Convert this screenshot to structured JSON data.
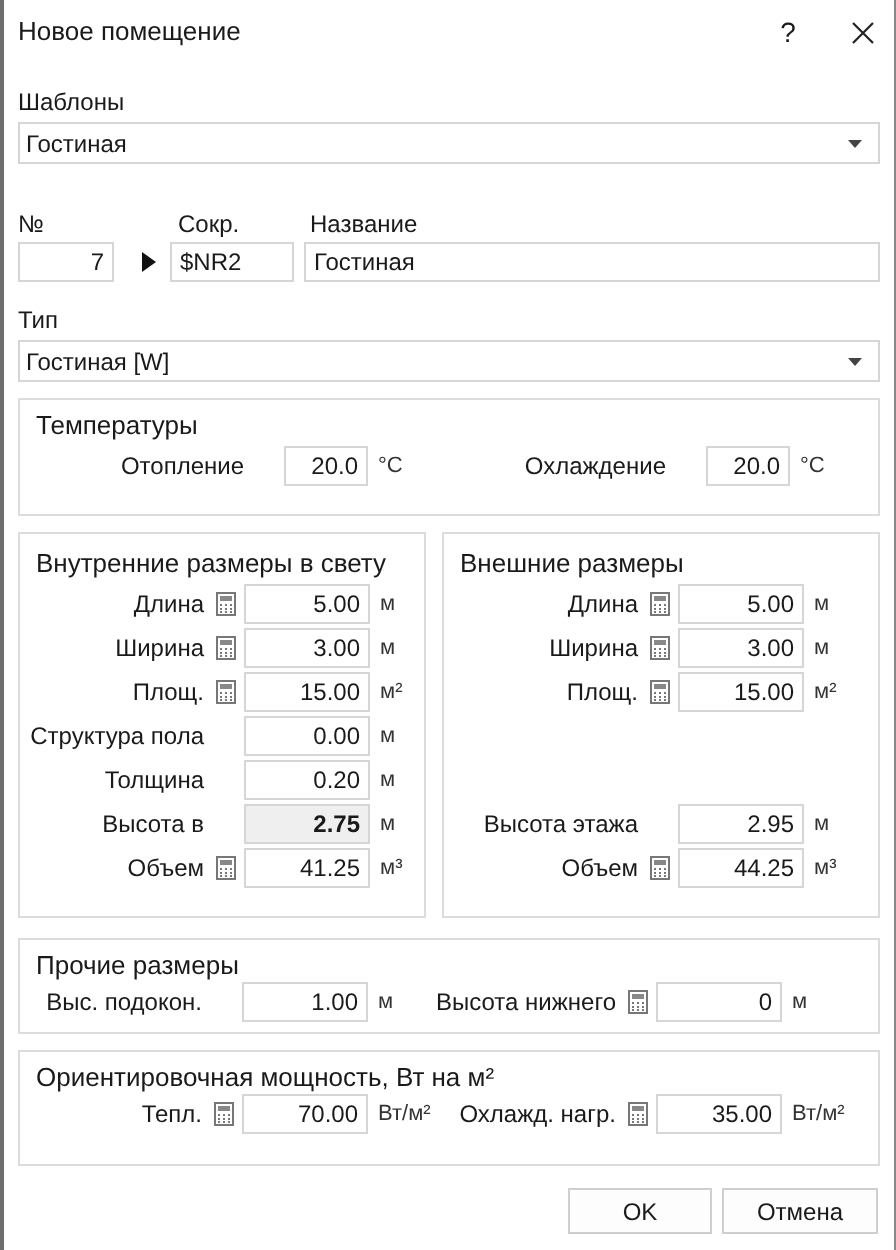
{
  "window": {
    "title": "Новое помещение",
    "help": "?"
  },
  "templates": {
    "label": "Шаблоны",
    "value": "Гостиная"
  },
  "ident": {
    "number_label": "№",
    "number": "7",
    "short_label": "Сокр.",
    "short": "$NR2",
    "name_label": "Название",
    "name": "Гостиная"
  },
  "type": {
    "label": "Тип",
    "value": "Гостиная [W]"
  },
  "temperatures": {
    "title": "Температуры",
    "fields": [
      {
        "label": "Отопление",
        "value": "20.0",
        "unit": "°C",
        "calculator": false,
        "readonly": false
      },
      {
        "label": "Охлаждение",
        "value": "20.0",
        "unit": "°C",
        "calculator": false,
        "readonly": false
      }
    ]
  },
  "inner": {
    "title": "Внутренние размеры в свету",
    "rows": [
      {
        "kind": "field",
        "label": "Длина",
        "value": "5.00",
        "unit": "м",
        "calculator": true,
        "readonly": false
      },
      {
        "kind": "field",
        "label": "Ширина",
        "value": "3.00",
        "unit": "м",
        "calculator": true,
        "readonly": false
      },
      {
        "kind": "field",
        "label": "Площ.",
        "value": "15.00",
        "unit": "м²",
        "calculator": true,
        "readonly": false
      },
      {
        "kind": "field",
        "label": "Структура пола",
        "value": "0.00",
        "unit": "м",
        "calculator": false,
        "readonly": false
      },
      {
        "kind": "field",
        "label": "Толщина",
        "value": "0.20",
        "unit": "м",
        "calculator": false,
        "readonly": false
      },
      {
        "kind": "field",
        "label": "Высота в",
        "value": "2.75",
        "unit": "м",
        "calculator": false,
        "readonly": true
      },
      {
        "kind": "field",
        "label": "Объем",
        "value": "41.25",
        "unit": "м³",
        "calculator": true,
        "readonly": false
      }
    ]
  },
  "outer": {
    "title": "Внешние размеры",
    "rows": [
      {
        "kind": "field",
        "label": "Длина",
        "value": "5.00",
        "unit": "м",
        "calculator": true,
        "readonly": false
      },
      {
        "kind": "field",
        "label": "Ширина",
        "value": "3.00",
        "unit": "м",
        "calculator": true,
        "readonly": false
      },
      {
        "kind": "field",
        "label": "Площ.",
        "value": "15.00",
        "unit": "м²",
        "calculator": true,
        "readonly": false
      },
      {
        "kind": "blank"
      },
      {
        "kind": "blank"
      },
      {
        "kind": "field",
        "label": "Высота этажа",
        "value": "2.95",
        "unit": "м",
        "calculator": false,
        "readonly": false
      },
      {
        "kind": "field",
        "label": "Объем",
        "value": "44.25",
        "unit": "м³",
        "calculator": true,
        "readonly": false
      }
    ]
  },
  "other": {
    "title": "Прочие размеры",
    "fields": [
      {
        "label": "Выс. подокон.",
        "value": "1.00",
        "unit": "м",
        "calculator": false,
        "readonly": false
      },
      {
        "label": "Высота нижнего",
        "value": "0",
        "unit": "м",
        "calculator": true,
        "readonly": false
      }
    ]
  },
  "power": {
    "title": "Ориентировочная мощность, Вт на м²",
    "fields": [
      {
        "label": "Тепл.",
        "value": "70.00",
        "unit": "Вт/м²",
        "calculator": true,
        "readonly": false
      },
      {
        "label": "Охлажд. нагр.",
        "value": "35.00",
        "unit": "Вт/м²",
        "calculator": true,
        "readonly": false
      }
    ]
  },
  "buttons": [
    "OK",
    "Отмена"
  ]
}
